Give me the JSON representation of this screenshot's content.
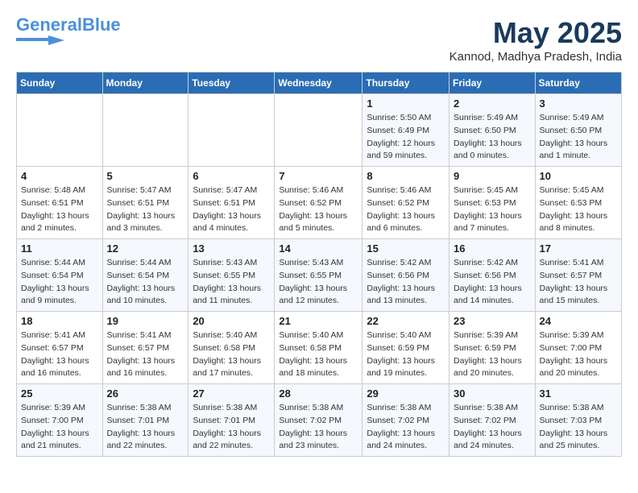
{
  "logo": {
    "general": "General",
    "blue": "Blue"
  },
  "title": "May 2025",
  "location": "Kannod, Madhya Pradesh, India",
  "days_of_week": [
    "Sunday",
    "Monday",
    "Tuesday",
    "Wednesday",
    "Thursday",
    "Friday",
    "Saturday"
  ],
  "weeks": [
    [
      {
        "num": "",
        "info": ""
      },
      {
        "num": "",
        "info": ""
      },
      {
        "num": "",
        "info": ""
      },
      {
        "num": "",
        "info": ""
      },
      {
        "num": "1",
        "info": "Sunrise: 5:50 AM\nSunset: 6:49 PM\nDaylight: 12 hours and 59 minutes."
      },
      {
        "num": "2",
        "info": "Sunrise: 5:49 AM\nSunset: 6:50 PM\nDaylight: 13 hours and 0 minutes."
      },
      {
        "num": "3",
        "info": "Sunrise: 5:49 AM\nSunset: 6:50 PM\nDaylight: 13 hours and 1 minute."
      }
    ],
    [
      {
        "num": "4",
        "info": "Sunrise: 5:48 AM\nSunset: 6:51 PM\nDaylight: 13 hours and 2 minutes."
      },
      {
        "num": "5",
        "info": "Sunrise: 5:47 AM\nSunset: 6:51 PM\nDaylight: 13 hours and 3 minutes."
      },
      {
        "num": "6",
        "info": "Sunrise: 5:47 AM\nSunset: 6:51 PM\nDaylight: 13 hours and 4 minutes."
      },
      {
        "num": "7",
        "info": "Sunrise: 5:46 AM\nSunset: 6:52 PM\nDaylight: 13 hours and 5 minutes."
      },
      {
        "num": "8",
        "info": "Sunrise: 5:46 AM\nSunset: 6:52 PM\nDaylight: 13 hours and 6 minutes."
      },
      {
        "num": "9",
        "info": "Sunrise: 5:45 AM\nSunset: 6:53 PM\nDaylight: 13 hours and 7 minutes."
      },
      {
        "num": "10",
        "info": "Sunrise: 5:45 AM\nSunset: 6:53 PM\nDaylight: 13 hours and 8 minutes."
      }
    ],
    [
      {
        "num": "11",
        "info": "Sunrise: 5:44 AM\nSunset: 6:54 PM\nDaylight: 13 hours and 9 minutes."
      },
      {
        "num": "12",
        "info": "Sunrise: 5:44 AM\nSunset: 6:54 PM\nDaylight: 13 hours and 10 minutes."
      },
      {
        "num": "13",
        "info": "Sunrise: 5:43 AM\nSunset: 6:55 PM\nDaylight: 13 hours and 11 minutes."
      },
      {
        "num": "14",
        "info": "Sunrise: 5:43 AM\nSunset: 6:55 PM\nDaylight: 13 hours and 12 minutes."
      },
      {
        "num": "15",
        "info": "Sunrise: 5:42 AM\nSunset: 6:56 PM\nDaylight: 13 hours and 13 minutes."
      },
      {
        "num": "16",
        "info": "Sunrise: 5:42 AM\nSunset: 6:56 PM\nDaylight: 13 hours and 14 minutes."
      },
      {
        "num": "17",
        "info": "Sunrise: 5:41 AM\nSunset: 6:57 PM\nDaylight: 13 hours and 15 minutes."
      }
    ],
    [
      {
        "num": "18",
        "info": "Sunrise: 5:41 AM\nSunset: 6:57 PM\nDaylight: 13 hours and 16 minutes."
      },
      {
        "num": "19",
        "info": "Sunrise: 5:41 AM\nSunset: 6:57 PM\nDaylight: 13 hours and 16 minutes."
      },
      {
        "num": "20",
        "info": "Sunrise: 5:40 AM\nSunset: 6:58 PM\nDaylight: 13 hours and 17 minutes."
      },
      {
        "num": "21",
        "info": "Sunrise: 5:40 AM\nSunset: 6:58 PM\nDaylight: 13 hours and 18 minutes."
      },
      {
        "num": "22",
        "info": "Sunrise: 5:40 AM\nSunset: 6:59 PM\nDaylight: 13 hours and 19 minutes."
      },
      {
        "num": "23",
        "info": "Sunrise: 5:39 AM\nSunset: 6:59 PM\nDaylight: 13 hours and 20 minutes."
      },
      {
        "num": "24",
        "info": "Sunrise: 5:39 AM\nSunset: 7:00 PM\nDaylight: 13 hours and 20 minutes."
      }
    ],
    [
      {
        "num": "25",
        "info": "Sunrise: 5:39 AM\nSunset: 7:00 PM\nDaylight: 13 hours and 21 minutes."
      },
      {
        "num": "26",
        "info": "Sunrise: 5:38 AM\nSunset: 7:01 PM\nDaylight: 13 hours and 22 minutes."
      },
      {
        "num": "27",
        "info": "Sunrise: 5:38 AM\nSunset: 7:01 PM\nDaylight: 13 hours and 22 minutes."
      },
      {
        "num": "28",
        "info": "Sunrise: 5:38 AM\nSunset: 7:02 PM\nDaylight: 13 hours and 23 minutes."
      },
      {
        "num": "29",
        "info": "Sunrise: 5:38 AM\nSunset: 7:02 PM\nDaylight: 13 hours and 24 minutes."
      },
      {
        "num": "30",
        "info": "Sunrise: 5:38 AM\nSunset: 7:02 PM\nDaylight: 13 hours and 24 minutes."
      },
      {
        "num": "31",
        "info": "Sunrise: 5:38 AM\nSunset: 7:03 PM\nDaylight: 13 hours and 25 minutes."
      }
    ]
  ]
}
